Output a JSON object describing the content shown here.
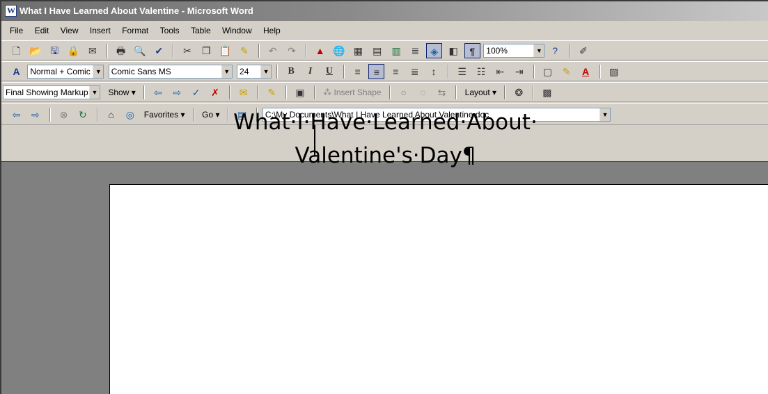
{
  "window": {
    "title": "What I Have Learned About Valentine - Microsoft Word"
  },
  "menu": [
    "File",
    "Edit",
    "View",
    "Insert",
    "Format",
    "Tools",
    "Table",
    "Window",
    "Help"
  ],
  "standard_toolbar": {
    "zoom": "100%"
  },
  "formatting_toolbar": {
    "style": "Normal + Comic",
    "font": "Comic Sans MS",
    "size": "24"
  },
  "reviewing_toolbar": {
    "display": "Final Showing Markup",
    "show_label": "Show",
    "insert_shape_label": "Insert Shape",
    "layout_label": "Layout"
  },
  "web_toolbar": {
    "favorites_label": "Favorites",
    "go_label": "Go",
    "address": "C:\\My Documents\\What I Have Learned About Valentine.doc"
  },
  "document": {
    "line1": "What·I·Have·Learned·About·",
    "line2": "Valentine's·Day¶"
  },
  "colors": {
    "title_gradient_start": "#6e6e6e",
    "title_gradient_end": "#c8c8c8",
    "chrome": "#d4d0c8",
    "workspace": "#808080"
  }
}
